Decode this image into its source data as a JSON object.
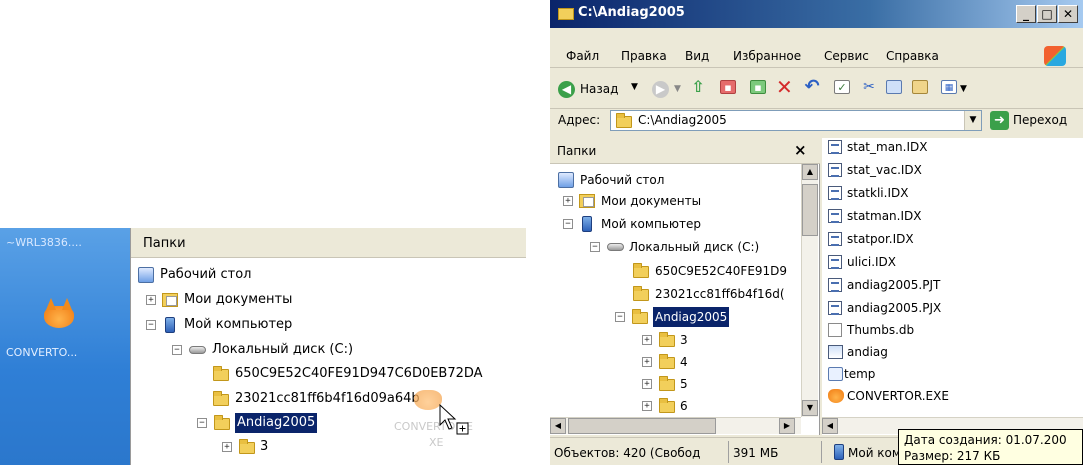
{
  "left_crop": {
    "desktop_label_top": "~WRL3836....",
    "desktop_label_bottom": "CONVERTO...",
    "pane_title": "Папки",
    "tree": [
      {
        "label": "Рабочий стол"
      },
      {
        "label": "Мои документы",
        "toggle": "+"
      },
      {
        "label": "Мой компьютер",
        "toggle": "−"
      },
      {
        "label": "Локальный диск (C:)",
        "toggle": "−"
      },
      {
        "label": "650C9E52C40FE91D947C6D0EB72DA"
      },
      {
        "label": "23021cc81ff6b4f16d09a64b"
      },
      {
        "label": "Andiag2005",
        "toggle": "−"
      },
      {
        "label": "3",
        "toggle": "+"
      }
    ],
    "drag_label_top": "CONVERTOR.E",
    "drag_label_bottom": "XE"
  },
  "window": {
    "title": "C:\\Andiag2005",
    "menu": [
      "Файл",
      "Правка",
      "Вид",
      "Избранное",
      "Сервис",
      "Справка"
    ],
    "back_label": "Назад",
    "address_label": "Адрес:",
    "address_value": "C:\\Andiag2005",
    "go_label": "Переход",
    "folders_title": "Папки",
    "close_glyph": "×",
    "tree": [
      {
        "label": "Рабочий стол"
      },
      {
        "label": "Мои документы",
        "toggle": "+"
      },
      {
        "label": "Мой компьютер",
        "toggle": "−"
      },
      {
        "label": "Локальный диск (C:)",
        "toggle": "−"
      },
      {
        "label": "650C9E52C40FE91D9"
      },
      {
        "label": "23021cc81ff6b4f16d("
      },
      {
        "label": "Andiag2005",
        "toggle": "−"
      },
      {
        "label": "3",
        "toggle": "+"
      },
      {
        "label": "4",
        "toggle": "+"
      },
      {
        "label": "5",
        "toggle": "+"
      },
      {
        "label": "6",
        "toggle": "+"
      }
    ],
    "files": [
      {
        "name": "stat_man.IDX",
        "icon": "table-file-icon"
      },
      {
        "name": "stat_vac.IDX",
        "icon": "table-file-icon"
      },
      {
        "name": "statkli.IDX",
        "icon": "table-file-icon"
      },
      {
        "name": "statman.IDX",
        "icon": "table-file-icon"
      },
      {
        "name": "statpor.IDX",
        "icon": "table-file-icon"
      },
      {
        "name": "ulici.IDX",
        "icon": "table-file-icon"
      },
      {
        "name": "andiag2005.PJT",
        "icon": "table-file-icon"
      },
      {
        "name": "andiag2005.PJX",
        "icon": "table-file-icon"
      },
      {
        "name": "Thumbs.db",
        "icon": "db-file-icon"
      },
      {
        "name": "andiag",
        "icon": "app-icon"
      },
      {
        "name": "temp",
        "icon": "shortcut-icon"
      },
      {
        "name": "CONVERTOR.EXE",
        "icon": "fox-exe-icon"
      }
    ],
    "status_left": "Объектов: 420 (Свобод",
    "status_size": "391 МБ",
    "status_pc": "Мой комп",
    "tooltip_line1": "Дата создания: 01.07.200",
    "tooltip_line2": "Размер: 217 КБ"
  }
}
